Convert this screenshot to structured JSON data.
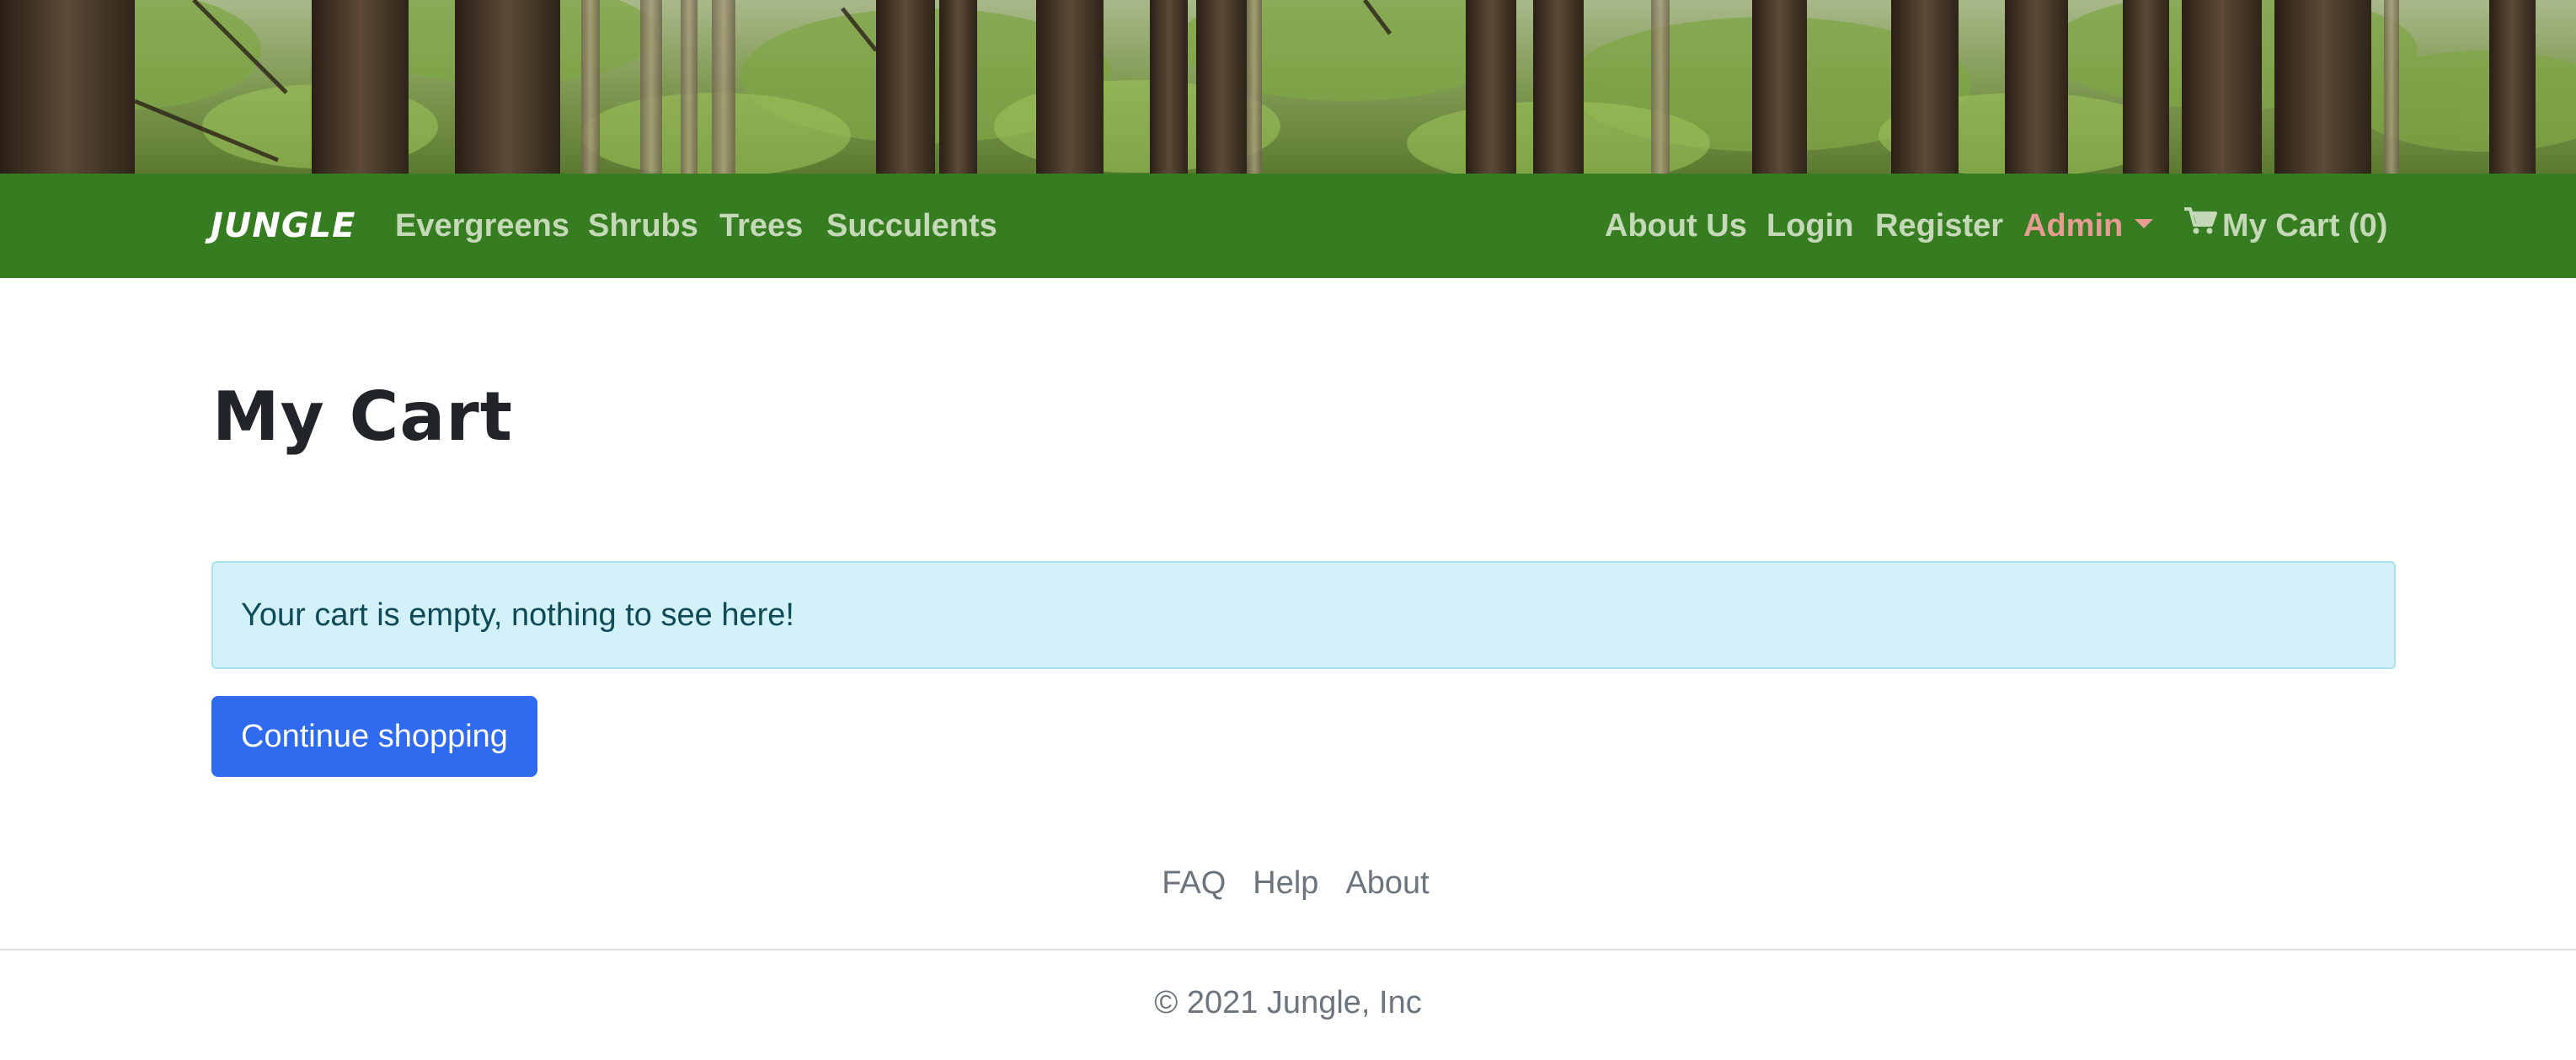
{
  "navbar": {
    "brand": "JUNGLE",
    "left_links": [
      "Evergreens",
      "Shrubs",
      "Trees",
      "Succulents"
    ],
    "right_links": {
      "about": "About Us",
      "login": "Login",
      "register": "Register",
      "admin": "Admin",
      "cart": "My Cart (0)"
    },
    "colors": {
      "background": "#367c20",
      "link": "#c5d9b8",
      "admin": "#e69c93"
    }
  },
  "main": {
    "title": "My Cart",
    "alert_text": "Your cart is empty, nothing to see here!",
    "continue_label": "Continue shopping",
    "colors": {
      "alert_bg": "#d3f1f9",
      "button_bg": "#2f6aef"
    }
  },
  "footer": {
    "links": [
      "FAQ",
      "Help",
      "About"
    ],
    "copyright": "© 2021 Jungle, Inc"
  },
  "icons": {
    "cart": "shopping-cart-icon",
    "admin_dropdown": "caret-down-icon"
  }
}
